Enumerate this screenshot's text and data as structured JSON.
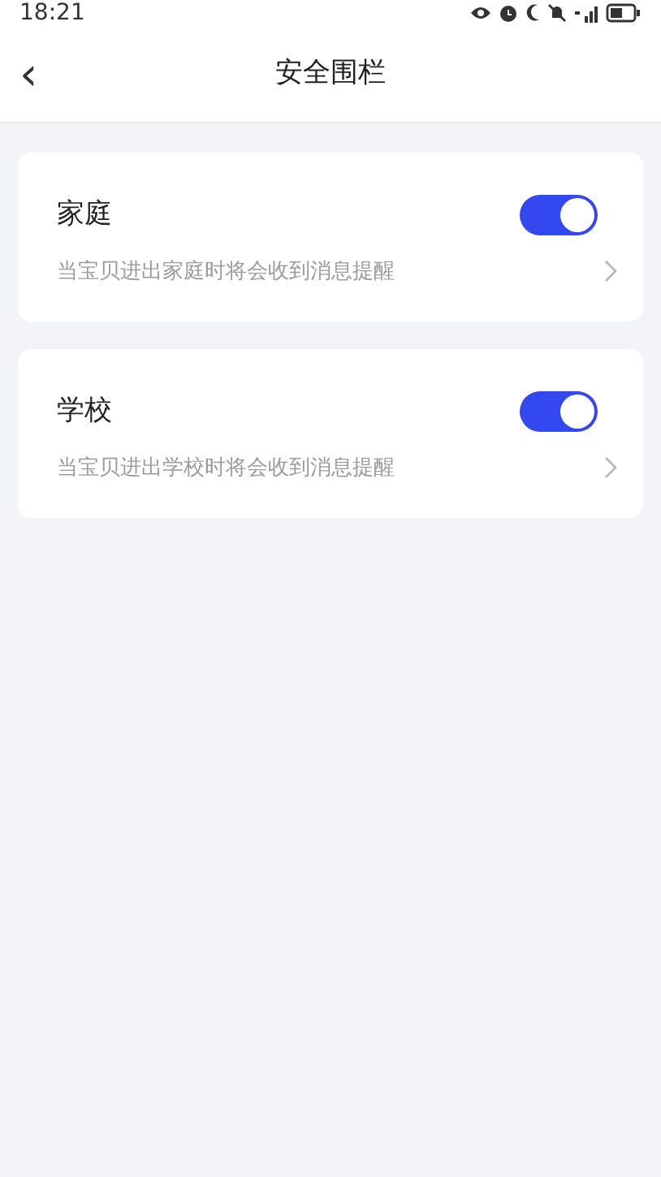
{
  "status_bar": {
    "time": "18:21"
  },
  "nav_bar": {
    "back": "‹",
    "title": "安全围栏"
  },
  "fences": [
    {
      "name": "家庭",
      "description": "当宝贝进出家庭时将会收到消息提醒",
      "on": true
    },
    {
      "name": "学校",
      "description": "当宝贝进出学校时将会收到消息提醒",
      "on": true
    }
  ]
}
